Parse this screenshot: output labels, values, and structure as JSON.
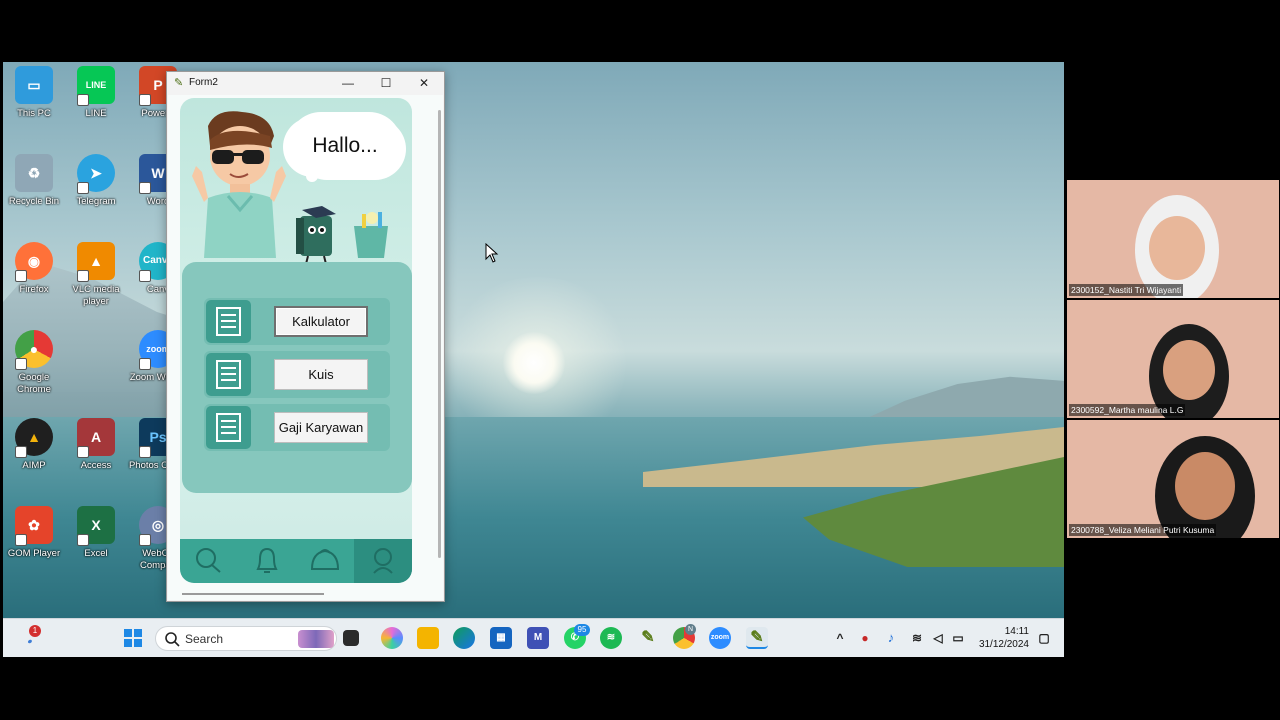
{
  "desktop": {
    "icons": [
      {
        "label": "This PC",
        "icon": "computer-icon",
        "color": "#2f9bdc"
      },
      {
        "label": "LINE",
        "icon": "line-icon",
        "color": "#06c755"
      },
      {
        "label": "PowerP",
        "icon": "powerpoint-icon",
        "color": "#d24726"
      },
      {
        "label": "Recycle Bin",
        "icon": "recycle-bin-icon",
        "color": "#8fa7b6"
      },
      {
        "label": "Telegram",
        "icon": "telegram-icon",
        "color": "#2aa3df"
      },
      {
        "label": "Word",
        "icon": "word-icon",
        "color": "#2b579a"
      },
      {
        "label": "Firefox",
        "icon": "firefox-icon",
        "color": "#ff7139"
      },
      {
        "label": "VLC media player",
        "icon": "vlc-icon",
        "color": "#f08a00"
      },
      {
        "label": "Canv",
        "icon": "canva-icon",
        "color": "#21b5c9"
      },
      {
        "label": "Google Chrome",
        "icon": "chrome-icon",
        "color": "#e53935"
      },
      {
        "label": "Zoom Workpl",
        "icon": "zoom-icon",
        "color": "#2d8cff"
      },
      {
        "label": "AIMP",
        "icon": "aimp-icon",
        "color": "#f2b20b"
      },
      {
        "label": "Access",
        "icon": "access-icon",
        "color": "#a4373a"
      },
      {
        "label": "Photos CS6 x",
        "icon": "photoshop-icon",
        "color": "#0d3a5c"
      },
      {
        "label": "GOM Player",
        "icon": "gom-player-icon",
        "color": "#e5442a"
      },
      {
        "label": "Excel",
        "icon": "excel-icon",
        "color": "#1d7044"
      },
      {
        "label": "WebCa Compan",
        "icon": "webcam-icon",
        "color": "#6b7fa8"
      }
    ]
  },
  "form2": {
    "title": "Form2",
    "minimize": "—",
    "maximize": "☐",
    "close": "✕",
    "greeting": "Hallo...",
    "menu": [
      {
        "label": "Kalkulator",
        "focused": true
      },
      {
        "label": "Kuis",
        "focused": false
      },
      {
        "label": "Gaji Karyawan",
        "focused": false
      }
    ],
    "nav": [
      "search-icon",
      "bell-icon",
      "bag-icon",
      "user-icon"
    ]
  },
  "taskbar": {
    "search_placeholder": "Search",
    "notification_badge": "1",
    "whatsapp_badge": "95",
    "chrome_badge": "N",
    "time": "14:11",
    "date": "31/12/2024"
  },
  "participants": [
    {
      "name": "2300152_Nastiti Tri Wijayanti"
    },
    {
      "name": "2300592_Martha maulina L.G"
    },
    {
      "name": "2300788_Veliza Meliani Putri Kusuma"
    }
  ]
}
